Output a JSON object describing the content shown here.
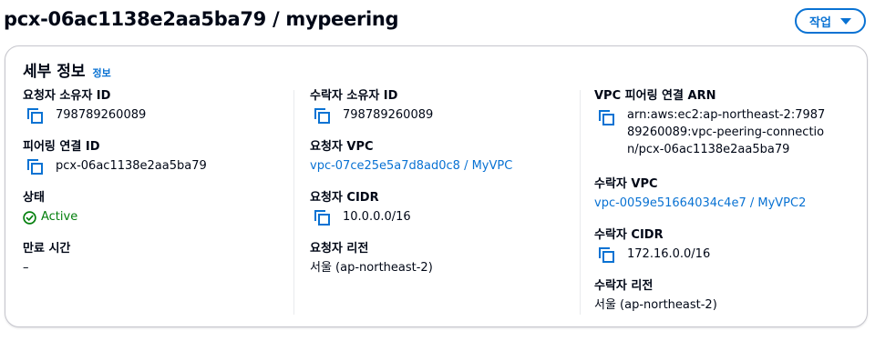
{
  "header": {
    "title": "pcx-06ac1138e2aa5ba79 / mypeering",
    "actions_label": "작업"
  },
  "details": {
    "heading": "세부 정보",
    "info_label": "정보",
    "requester_owner": {
      "label": "요청자 소유자 ID",
      "value": "798789260089"
    },
    "peering_id": {
      "label": "피어링 연결 ID",
      "value": "pcx-06ac1138e2aa5ba79"
    },
    "status": {
      "label": "상태",
      "value": "Active",
      "color": "#037f0c"
    },
    "expiration": {
      "label": "만료 시간",
      "value": "–"
    },
    "accepter_owner": {
      "label": "수락자 소유자 ID",
      "value": "798789260089"
    },
    "requester_vpc": {
      "label": "요청자 VPC",
      "value": "vpc-07ce25e5a7d8ad0c8 / MyVPC"
    },
    "requester_cidr": {
      "label": "요청자 CIDR",
      "value": "10.0.0.0/16"
    },
    "requester_region": {
      "label": "요청자 리전",
      "value": "서울 (ap-northeast-2)"
    },
    "arn": {
      "label": "VPC 피어링 연결 ARN",
      "value": "arn:aws:ec2:ap-northeast-2:798789260089:vpc-peering-connection/pcx-06ac1138e2aa5ba79"
    },
    "accepter_vpc": {
      "label": "수락자 VPC",
      "value": "vpc-0059e51664034c4e7 / MyVPC2"
    },
    "accepter_cidr": {
      "label": "수락자 CIDR",
      "value": "172.16.0.0/16"
    },
    "accepter_region": {
      "label": "수락자 리전",
      "value": "서울 (ap-northeast-2)"
    }
  },
  "colors": {
    "link": "#0972d3",
    "success": "#037f0c",
    "text": "#000716"
  },
  "icons": {
    "copy": "copy-icon",
    "status": "success-check-icon",
    "caret": "caret-down-icon"
  }
}
